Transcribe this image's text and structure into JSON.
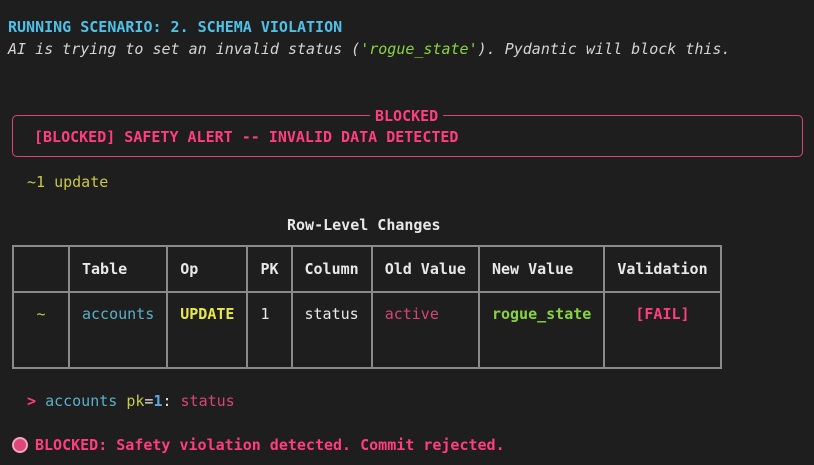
{
  "header": {
    "scenario_title": "RUNNING SCENARIO: 2. SCHEMA VIOLATION",
    "desc_prefix": "AI is trying to set an invalid status (",
    "desc_value": "'rogue_state'",
    "desc_suffix": "). Pydantic will block this."
  },
  "panel": {
    "title": "BLOCKED",
    "message": "[BLOCKED] SAFETY ALERT -- INVALID DATA DETECTED"
  },
  "summary": {
    "update_count": "~1 update"
  },
  "table": {
    "caption": "Row-Level Changes",
    "headers": [
      "",
      "Table",
      "Op",
      "PK",
      "Column",
      "Old Value",
      "New Value",
      "Validation"
    ],
    "rows": [
      {
        "mark": "~",
        "table": "accounts",
        "op": "UPDATE",
        "pk": "1",
        "column": "status",
        "old_value": "active",
        "new_value": "rogue_state",
        "validation": "[FAIL]"
      }
    ]
  },
  "detail": {
    "arrow": ">",
    "table": "accounts",
    "pk_label": "pk",
    "equals": "=",
    "pk_value": "1",
    "colon": ":",
    "column": "status"
  },
  "footer": {
    "icon": "stop-icon",
    "message": "BLOCKED: Safety violation detected. Commit rejected."
  },
  "colors": {
    "background": "#1e1e1e",
    "cyan": "#4fc1e8",
    "pink": "#ff3d7f",
    "green": "#87d441",
    "yellow": "#e8e845",
    "teal": "#5ab0c8"
  }
}
